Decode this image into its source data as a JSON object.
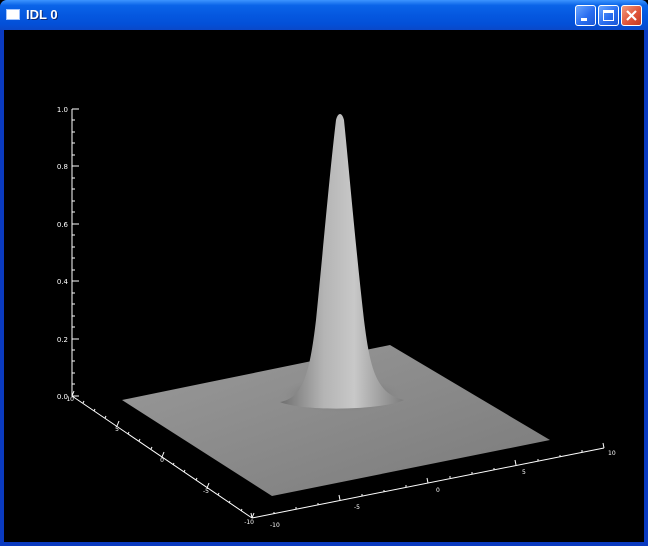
{
  "window": {
    "title": "IDL 0",
    "icon": "app-window-icon",
    "buttons": {
      "minimize": "minimize-icon",
      "maximize": "maximize-icon",
      "close": "close-icon"
    }
  },
  "plot": {
    "z_tick_labels": [
      "0.0",
      "0.2",
      "0.4",
      "0.6",
      "0.8",
      "1.0"
    ],
    "x_tick_labels": [
      "-10",
      "-5",
      "0",
      "5",
      "10"
    ],
    "y_tick_labels": [
      "-10",
      "-5",
      "0",
      "5",
      "10"
    ],
    "colors": {
      "background": "#000000",
      "axes": "#ffffff",
      "surface": "#8c8c8c"
    }
  }
}
